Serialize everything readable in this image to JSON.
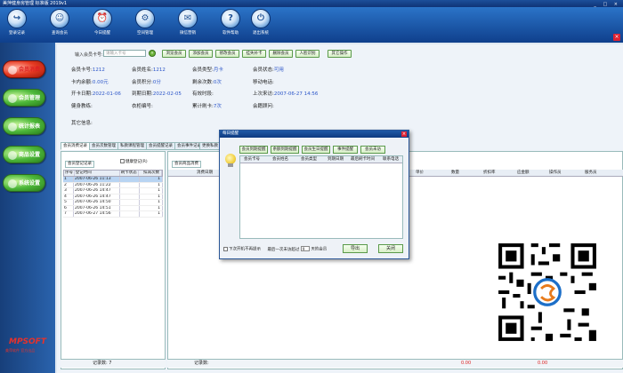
{
  "window": {
    "title": "美萍健身房管理 标准版 2019v1",
    "controls": "_ □ ×"
  },
  "toolbar": [
    {
      "label": "登录记录",
      "icon": "login-icon"
    },
    {
      "label": "查询会员",
      "icon": "search-member-icon"
    },
    {
      "label": "今日提醒",
      "icon": "reminder-icon"
    },
    {
      "label": "空间管理",
      "icon": "space-icon"
    },
    {
      "label": "微信营销",
      "icon": "wechat-icon"
    },
    {
      "label": "软件帮助",
      "icon": "help-icon"
    },
    {
      "label": "退出系统",
      "icon": "power-icon"
    }
  ],
  "sidebar": [
    {
      "label": "会员消费",
      "style": "red"
    },
    {
      "label": "会员管理",
      "style": "green"
    },
    {
      "label": "统计报表",
      "style": "green"
    },
    {
      "label": "商品设置",
      "style": "green"
    },
    {
      "label": "系统设置",
      "style": "green"
    }
  ],
  "brand": {
    "logo": "MPSOFT",
    "sub": "美萍软件 官方出品"
  },
  "search": {
    "label": "输入会员卡号:",
    "placeholder": "请输入卡号",
    "go": "»",
    "buttons": [
      "浏览会员",
      "添加会员",
      "修改会员",
      "挂失补卡",
      "删除会员",
      "人脸识别",
      "其它操作"
    ]
  },
  "member": {
    "card_no_label": "会员卡号:",
    "card_no": "1212",
    "name_label": "会员姓名:",
    "name": "1212",
    "type_label": "会员类型:",
    "type": "月卡",
    "status_label": "会员状态:",
    "status": "可用",
    "balance_label": "卡内余额:",
    "balance": "0.00元",
    "points_label": "会员积分:",
    "points": "0分",
    "remain_label": "剩余次数:",
    "remain": "0次",
    "mobile_label": "移动电话:",
    "open_label": "开卡日期:",
    "open": "2022-01-06",
    "expire_label": "到期日期:",
    "expire": "2022-02-05",
    "valid_label": "有效时段:",
    "last_label": "上次来访:",
    "last": "2007-06-27 14:56",
    "coach_label": "健身教练:",
    "locker_label": "衣柜编号:",
    "total_label": "累计刷卡:",
    "total": "7次",
    "adviser_label": "会籍顾问:",
    "other_label": "其它信息:"
  },
  "tabs": [
    "会员消费记录",
    "会员次数管理",
    "私教课程管理",
    "会员提醒记录",
    "会员事件记录",
    "更换私教"
  ],
  "left_panel": {
    "subtab": "会员登记记录",
    "check_label": "健康登记(R)",
    "columns": [
      "序号",
      "登记时间",
      "刷卡状态",
      "扣减次数"
    ],
    "rows": [
      [
        "1",
        "2007-06-26 11:13",
        "",
        "1"
      ],
      [
        "2",
        "2007-06-26 11:22",
        "",
        "1"
      ],
      [
        "3",
        "2007-06-26 14:47",
        "",
        "1"
      ],
      [
        "4",
        "2007-06-26 14:47",
        "",
        "1"
      ],
      [
        "5",
        "2007-06-26 14:50",
        "",
        "1"
      ],
      [
        "6",
        "2007-06-26 14:51",
        "",
        "1"
      ],
      [
        "7",
        "2007-06-27 14:56",
        "",
        "1"
      ]
    ],
    "footer_label": "记录数: 7"
  },
  "right_panel": {
    "subtab": "会员商品消费",
    "columns": [
      "消费日期",
      "单价",
      "数量",
      "折扣率",
      "应金额",
      "操作员",
      "服务员"
    ],
    "footer_label": "记录数:",
    "footer_val1": "0.00",
    "footer_val2": "0.00"
  },
  "dialog": {
    "title": "每日提醒",
    "close": "×",
    "tabs": [
      "会员到期提醒",
      "余额到期提醒",
      "会员生日提醒",
      "事件提醒",
      "会员未访"
    ],
    "columns": [
      "会员卡号",
      "会员姓名",
      "会员类型",
      "到期日期",
      "最后刷卡时间",
      "联系电话"
    ],
    "checkbox_label": "下次开机不再提示",
    "days_prefix": "最后一次未访超过",
    "days_value": "9",
    "days_suffix": "天的会员",
    "export_button": "导出",
    "close_button": "关闭"
  }
}
